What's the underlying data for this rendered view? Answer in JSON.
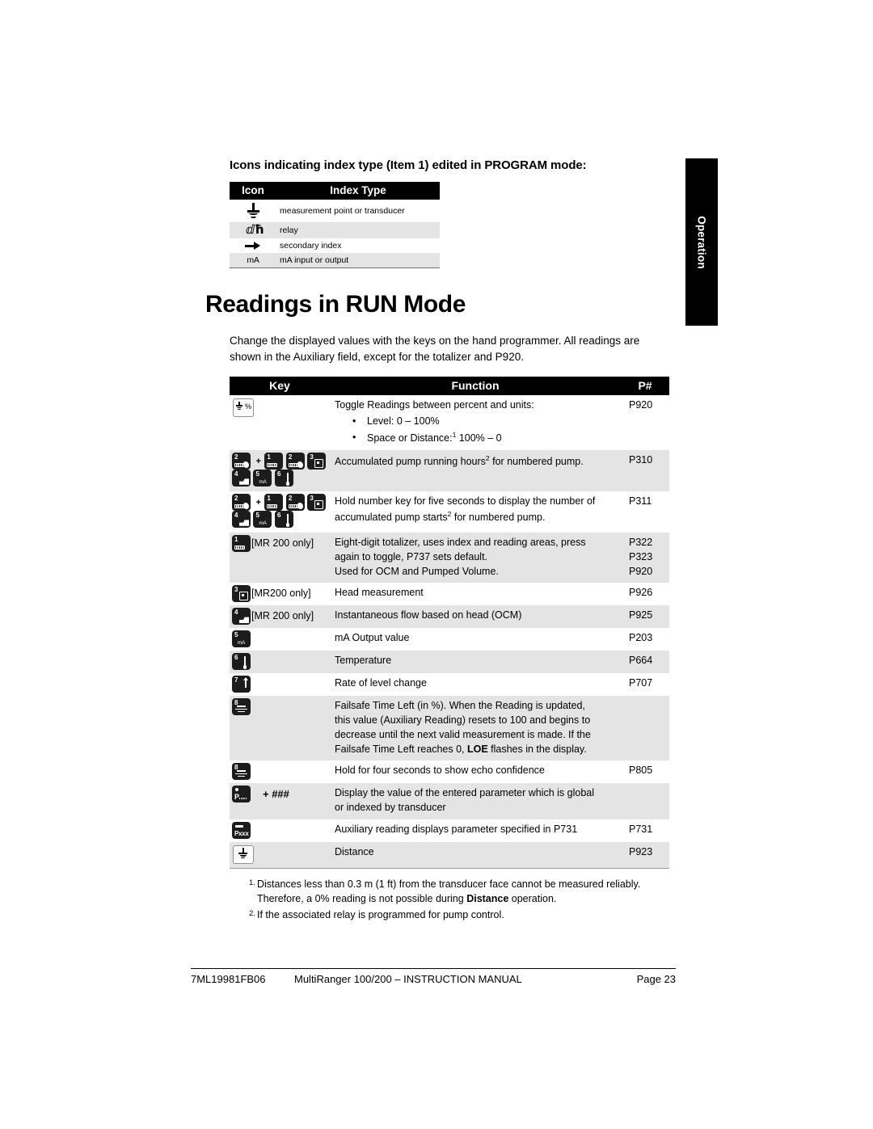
{
  "side_tab": {
    "label": "Operation"
  },
  "icon_section": {
    "intro": "Icons indicating index type (Item 1) edited in PROGRAM mode:",
    "headers": {
      "icon": "Icon",
      "index_type": "Index Type"
    },
    "rows": [
      {
        "icon": "transducer-icon",
        "label": "measurement point or transducer"
      },
      {
        "icon": "relay-icon",
        "label": "relay"
      },
      {
        "icon": "arrow-right-icon",
        "label": "secondary index"
      },
      {
        "icon": "ma-icon",
        "icon_text": "mA",
        "label": "mA input or output"
      }
    ]
  },
  "heading": "Readings in RUN Mode",
  "intro_paragraph": "Change the displayed values with the keys on the hand programmer. All readings are shown in the Auxiliary field, except for the totalizer and P920.",
  "key_table": {
    "headers": {
      "key": "Key",
      "function": "Function",
      "pnum": "P#"
    },
    "rows": [
      {
        "keys_desc": "percent-key",
        "function": "Toggle Readings between percent and units:",
        "bullets": [
          "Level: 0 – 100%",
          "Space or Distance:¹ 100% – 0"
        ],
        "bullet_1": "Level: 0 – 100%",
        "bullet_2_pre": "Space or Distance:",
        "bullet_2_sup": "1",
        "bullet_2_post": " 100% – 0",
        "pnum": "P920"
      },
      {
        "keys_desc": "key-2-plus-keys-1-2-3-4-5-6",
        "function_pre": "Accumulated pump running hours",
        "function_sup": "2",
        "function_post": " for numbered pump.",
        "pnum": "P310"
      },
      {
        "keys_desc": "key-2-plus-keys-1-2-3-4-5-6",
        "function_pre": "Hold number key for five seconds to display the number of accumulated pump starts",
        "function_sup": "2",
        "function_post": " for numbered pump.",
        "pnum": "P311"
      },
      {
        "keys_desc": "key-1",
        "key_note": "[MR 200 only]",
        "function": "Eight-digit totalizer, uses index and reading areas, press again to toggle, P737 sets default.\nUsed for OCM and Pumped Volume.",
        "function_line_1": "Eight-digit totalizer, uses index and reading areas, press",
        "function_line_2": "again to toggle, P737 sets default.",
        "function_line_3": "Used for OCM and Pumped Volume.",
        "pnum": "P322\nP323\nP920"
      },
      {
        "keys_desc": "key-3",
        "key_note": "[MR200 only]",
        "function": "Head measurement",
        "pnum": "P926"
      },
      {
        "keys_desc": "key-4",
        "key_note": "[MR 200 only]",
        "function": "Instantaneous flow based on head (OCM)",
        "pnum": "P925"
      },
      {
        "keys_desc": "key-5",
        "function": "mA Output value",
        "pnum": "P203"
      },
      {
        "keys_desc": "key-6",
        "function": "Temperature",
        "pnum": "P664"
      },
      {
        "keys_desc": "key-7",
        "function": "Rate of level change",
        "pnum": "P707"
      },
      {
        "keys_desc": "key-8",
        "function_line_1": "Failsafe Time Left (in %). When the Reading is updated,",
        "function_line_2": "this value (Auxiliary Reading) resets to 100 and begins to",
        "function_line_3": "decrease until the next valid measurement is made. If the",
        "function_line_4_pre": "Failsafe Time Left reaches 0, ",
        "function_line_4_bold": "LOE",
        "function_line_4_post": " flashes in the display.",
        "pnum": ""
      },
      {
        "keys_desc": "key-8",
        "function": "Hold for four seconds to show echo confidence",
        "pnum": "P805"
      },
      {
        "keys_desc": "key-p",
        "key_note": "+ ###",
        "function_line_1": "Display the value of the entered parameter which is global",
        "function_line_2": "or indexed by transducer",
        "pnum": ""
      },
      {
        "keys_desc": "key-pxxx",
        "function": "Auxiliary reading displays parameter specified in P731",
        "pnum": "P731"
      },
      {
        "keys_desc": "transducer-key",
        "function": "Distance",
        "pnum": "P923"
      }
    ]
  },
  "footnotes": [
    {
      "num": "1.",
      "pre": "Distances less than 0.3 m (1 ft) from the transducer face cannot be measured reliably. Therefore, a 0% reading is not possible during ",
      "bold": "Distance",
      "post": " operation."
    },
    {
      "num": "2.",
      "pre": "If the associated relay is programmed for pump control.",
      "bold": "",
      "post": ""
    }
  ],
  "footer": {
    "code": "7ML19981FB06",
    "title": "MultiRanger 100/200 – INSTRUCTION MANUAL",
    "page": "Page 23"
  }
}
